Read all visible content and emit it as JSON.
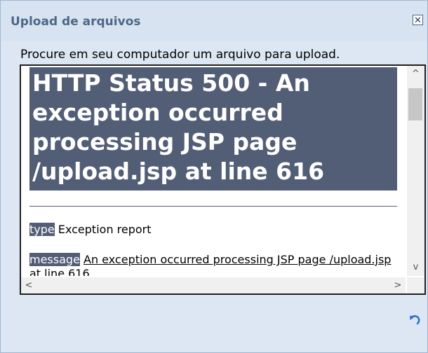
{
  "dialog": {
    "title": "Upload de arquivos",
    "close_symbol": "✕",
    "instruction": "Procure em seu computador um arquivo para upload."
  },
  "error_page": {
    "heading": "HTTP Status 500 - An exception occurred processing JSP page /upload.jsp at line 616",
    "type_label": "type",
    "type_value": " Exception report",
    "message_label": "message",
    "message_value": "An exception occurred processing JSP page /upload.jsp at line 616"
  },
  "scrollbars": {
    "up_symbol": "^",
    "down_symbol": "v",
    "left_symbol": "<",
    "right_symbol": ">"
  },
  "icons": {
    "close": "close-icon",
    "refresh": "refresh-icon"
  },
  "colors": {
    "accent_header_bg": "#525d76",
    "dialog_bg": "#dde7f3",
    "title_text": "#4e6787",
    "refresh_icon": "#2f6fd0"
  }
}
